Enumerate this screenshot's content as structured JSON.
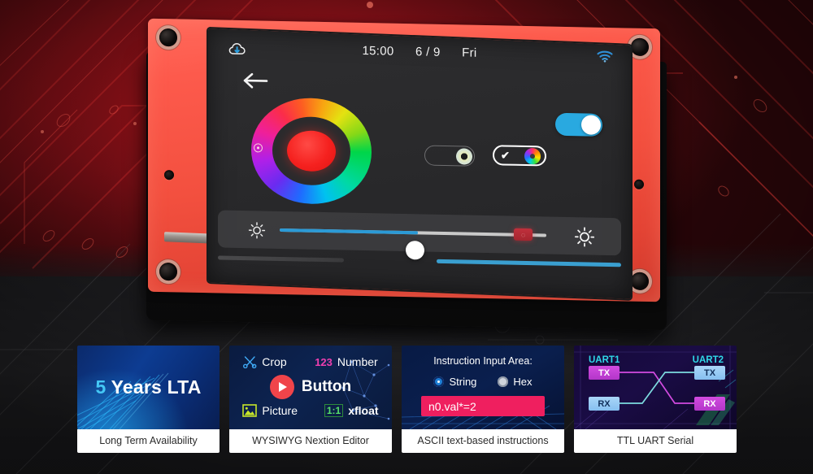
{
  "device": {
    "name": "nextion-hmi-display",
    "screen": {
      "statusbar": {
        "cloud_icon": "cloud-download-icon",
        "time": "15:00",
        "date": "6 / 9",
        "weekday": "Fri",
        "wifi_icon": "wifi-icon"
      },
      "back_icon": "back-arrow-icon",
      "color_wheel": {
        "name": "color-wheel",
        "selected_color": "#f5211f",
        "marker_position": "left"
      },
      "toggles": [
        {
          "name": "toggle-warm-cool",
          "state": "off",
          "knob": "pale-ring"
        },
        {
          "name": "toggle-rgb-mode",
          "state": "on",
          "knob": "rainbow",
          "check": "✔"
        }
      ],
      "power_toggle": {
        "name": "power-toggle",
        "state": "on",
        "color": "#29a9e0"
      },
      "brightness": {
        "left_icon": "sun-dim-icon",
        "right_icon": "sun-bright-icon",
        "value_percent": 52,
        "fill_color": "#2b9ad6",
        "badge_icon": "alert-badge-icon"
      },
      "bottom_bars": [
        {
          "name": "progress-bar-left",
          "color": "#4a4a4c"
        },
        {
          "name": "progress-bar-right",
          "color": "#3a9fd0"
        }
      ]
    }
  },
  "cards": [
    {
      "id": "card-lta",
      "headline_num": "5",
      "headline_rest": " Years LTA",
      "label": "Long Term Availability",
      "accent": "#44c8f5"
    },
    {
      "id": "card-editor",
      "items": [
        {
          "icon": "scissors-icon",
          "text": "Crop"
        },
        {
          "icon": "number-123-icon",
          "text": "Number"
        },
        {
          "icon": "play-button-icon",
          "text": "Button"
        },
        {
          "icon": "picture-icon",
          "text": "Picture"
        },
        {
          "icon": "ratio-1-1-icon",
          "text": "xfloat"
        }
      ],
      "badge_123": "123",
      "badge_ratio": "1:1",
      "label": "WYSIWYG Nextion Editor"
    },
    {
      "id": "card-ascii",
      "title": "Instruction Input Area:",
      "radios": [
        {
          "label": "String",
          "selected": true
        },
        {
          "label": "Hex",
          "selected": false
        }
      ],
      "input_value": "n0.val*=2",
      "input_color": "#ef1f5f",
      "label": "ASCII text-based instructions"
    },
    {
      "id": "card-uart",
      "left_title": "UART1",
      "right_title": "UART2",
      "pins": [
        {
          "side": "left",
          "name": "TX",
          "color": "magenta"
        },
        {
          "side": "left",
          "name": "RX",
          "color": "blue"
        },
        {
          "side": "right",
          "name": "TX",
          "color": "blue"
        },
        {
          "side": "right",
          "name": "RX",
          "color": "magenta"
        }
      ],
      "label": "TTL UART Serial"
    }
  ]
}
